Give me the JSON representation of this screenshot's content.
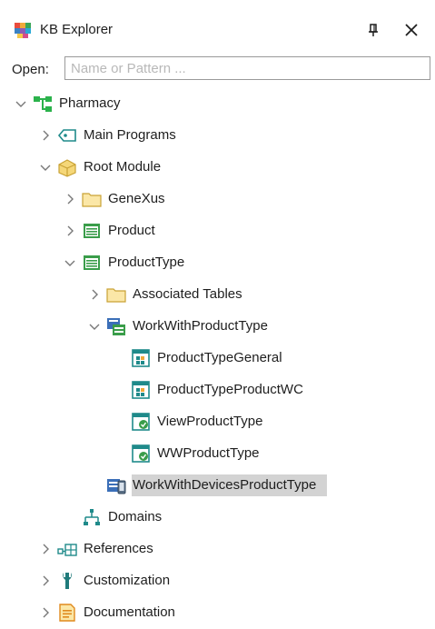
{
  "window": {
    "title": "KB Explorer",
    "pin_icon": "pin-icon",
    "close_icon": "close-icon"
  },
  "open": {
    "label": "Open:",
    "placeholder": "Name or Pattern ...",
    "value": ""
  },
  "tree": {
    "nodes": [
      {
        "label": "Pharmacy",
        "icon": "kb-root-icon",
        "expanded": true
      },
      {
        "label": "Main Programs",
        "icon": "main-programs-icon",
        "expanded": false
      },
      {
        "label": "Root Module",
        "icon": "module-icon",
        "expanded": true
      },
      {
        "label": "GeneXus",
        "icon": "folder-icon",
        "expanded": false
      },
      {
        "label": "Product",
        "icon": "transaction-icon",
        "expanded": false
      },
      {
        "label": "ProductType",
        "icon": "transaction-icon",
        "expanded": true
      },
      {
        "label": "Associated Tables",
        "icon": "folder-icon",
        "expanded": false
      },
      {
        "label": "WorkWithProductType",
        "icon": "work-with-pattern-icon",
        "expanded": true
      },
      {
        "label": "ProductTypeGeneral",
        "icon": "web-component-icon"
      },
      {
        "label": "ProductTypeProductWC",
        "icon": "web-component-icon"
      },
      {
        "label": "ViewProductType",
        "icon": "web-panel-icon"
      },
      {
        "label": "WWProductType",
        "icon": "web-panel-icon"
      },
      {
        "label": "WorkWithDevicesProductType",
        "icon": "work-with-devices-icon",
        "selected": true
      },
      {
        "label": "Domains",
        "icon": "domains-icon"
      },
      {
        "label": "References",
        "icon": "references-icon",
        "expanded": false
      },
      {
        "label": "Customization",
        "icon": "customization-icon",
        "expanded": false
      },
      {
        "label": "Documentation",
        "icon": "documentation-icon",
        "expanded": false
      }
    ]
  },
  "colors": {
    "selection_bg": "#d3d3d3",
    "folder": "#f5d778",
    "transaction": "#3a9d4a",
    "kb_green": "#2bb24c",
    "webpanel_teal": "#1f8a8a"
  }
}
